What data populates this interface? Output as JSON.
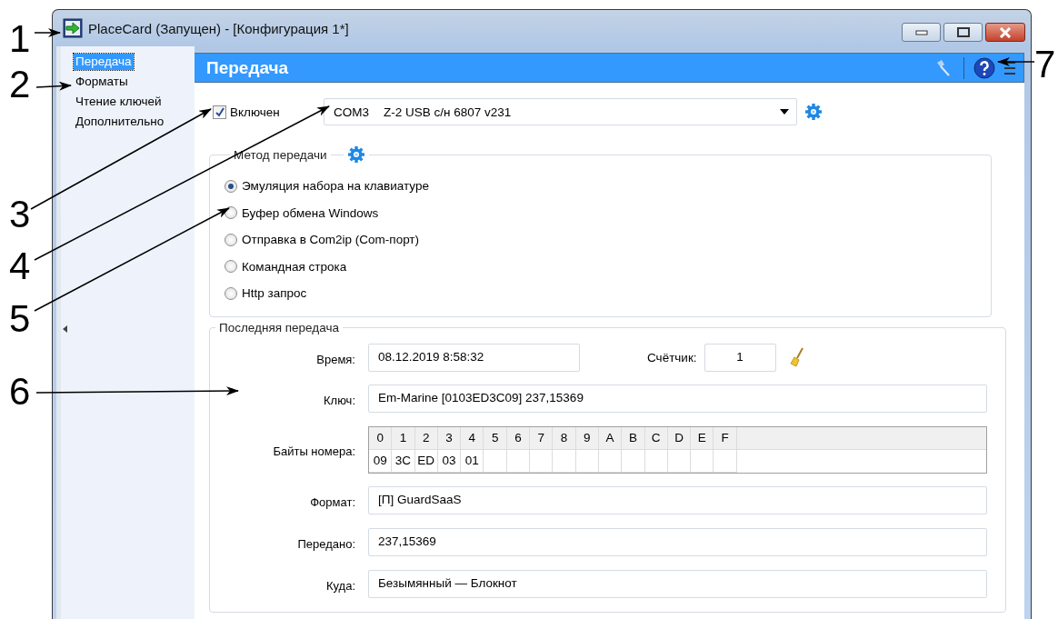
{
  "callouts": [
    {
      "label": "1"
    },
    {
      "label": "2"
    },
    {
      "label": "3"
    },
    {
      "label": "4"
    },
    {
      "label": "5"
    },
    {
      "label": "6"
    },
    {
      "label": "7"
    }
  ],
  "window": {
    "title": "PlaceCard (Запущен) - [Конфигурация 1*]"
  },
  "sidebar": {
    "items": [
      {
        "label": "Передача",
        "selected": true
      },
      {
        "label": "Форматы",
        "selected": false
      },
      {
        "label": "Чтение ключей",
        "selected": false
      },
      {
        "label": "Дополнительно",
        "selected": false
      }
    ]
  },
  "panel": {
    "title": "Передача"
  },
  "transmission": {
    "enabled_label": "Включен",
    "enabled": true,
    "port": "COM3",
    "device": "Z-2 USB с/н 6807 v231"
  },
  "method": {
    "title": "Метод передачи",
    "options": [
      {
        "label": "Эмуляция набора на клавиатуре",
        "selected": true
      },
      {
        "label": "Буфер обмена Windows",
        "selected": false
      },
      {
        "label": "Отправка в Com2ip (Com-порт)",
        "selected": false
      },
      {
        "label": "Командная строка",
        "selected": false
      },
      {
        "label": "Http запрос",
        "selected": false
      }
    ]
  },
  "last": {
    "title": "Последняя передача",
    "time_label": "Время:",
    "time": "08.12.2019 8:58:32",
    "counter_label": "Счётчик:",
    "counter": "1",
    "key_label": "Ключ:",
    "key": "Em-Marine [0103ED3C09] 237,15369",
    "bytes_label": "Байты номера:",
    "byte_columns": [
      "0",
      "1",
      "2",
      "3",
      "4",
      "5",
      "6",
      "7",
      "8",
      "9",
      "A",
      "B",
      "C",
      "D",
      "E",
      "F"
    ],
    "byte_values": [
      "09",
      "3C",
      "ED",
      "03",
      "01"
    ],
    "format_label": "Формат:",
    "format": "[П] GuardSaaS",
    "sent_label": "Передано:",
    "sent": "237,15369",
    "dest_label": "Куда:",
    "dest": "Безымянный — Блокнот"
  }
}
